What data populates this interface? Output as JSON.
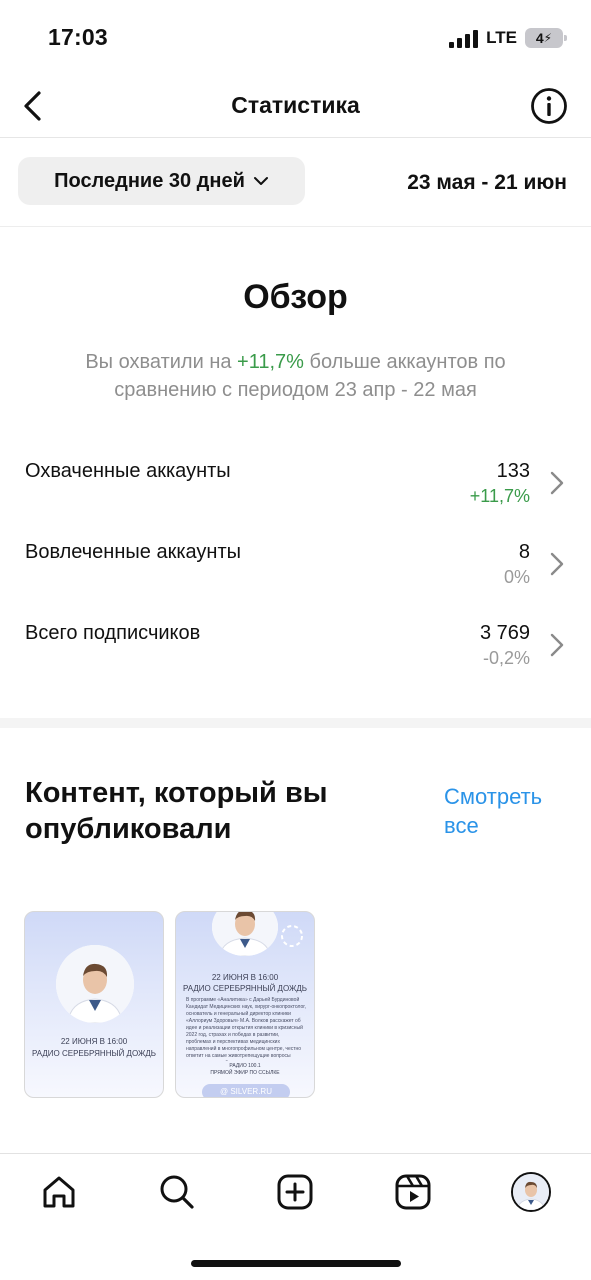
{
  "status_bar": {
    "time": "17:03",
    "network": "LTE",
    "battery": "4"
  },
  "header": {
    "title": "Статистика",
    "back_icon": "chevron-left-icon",
    "info_icon": "info-icon"
  },
  "period": {
    "selected": "Последние 30 дней",
    "range": "23 мая - 21 июн"
  },
  "overview": {
    "title": "Обзор",
    "desc_before": "Вы охватили на ",
    "desc_highlight": "+11,7%",
    "desc_after": " больше аккаунтов по сравнению с периодом 23 апр - 22 мая",
    "metrics": [
      {
        "label": "Охваченные аккаунты",
        "value": "133",
        "change": "+11,7%"
      },
      {
        "label": "Вовлеченные аккаунты",
        "value": "8",
        "change": "0%"
      },
      {
        "label": "Всего подписчиков",
        "value": "3 769",
        "change": "-0,2%"
      }
    ]
  },
  "content": {
    "title": "Контент, который вы опубликовали",
    "see_all": "Смотреть все",
    "posts": [
      {
        "line1": "22 ИЮНЯ В 16:00",
        "line2": "РАДИО СЕРЕБРЯННЫЙ ДОЖДЬ"
      },
      {
        "line1": "22 ИЮНЯ В 16:00",
        "line2": "РАДИО СЕРЕБРЯННЫЙ ДОЖДЬ",
        "body": "В программе «Аналитика» с Дарьей Бурдиновой Кандидат Медицинских наук, хирург-онкопроктолог, основатель и генеральный директор клиники «Аллориум Здоровья» М.А. Волков расскажет об идее и реализации открытия клиники в кризисный 2022 год, страхах и победах в развитии, проблемах и перспективах медицинских направлений в многопрофильном центре, честно ответит на самые животрепещущие вопросы радиослушателей",
        "footer1": "РАДИО 100.1",
        "footer2": "ПРЯМОЙ ЭФИР ПО ССЫЛКЕ",
        "url": "SILVER.RU"
      }
    ]
  },
  "nav": {
    "items": [
      "home-icon",
      "search-icon",
      "create-icon",
      "reels-icon",
      "profile-avatar"
    ]
  },
  "colors": {
    "accent_green": "#3a9b4a",
    "link_blue": "#2a93e8",
    "muted_gray": "#8e8e8e"
  }
}
